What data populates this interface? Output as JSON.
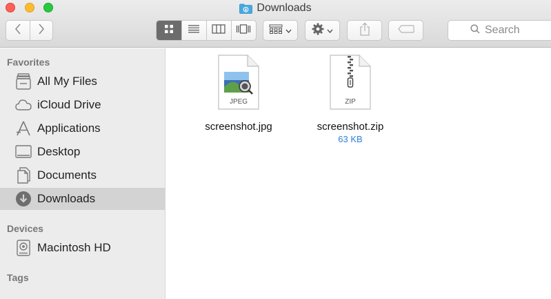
{
  "window": {
    "title": "Downloads",
    "title_icon": "folder-downloads-icon"
  },
  "toolbar": {
    "back_icon": "chevron-left-icon",
    "forward_icon": "chevron-right-icon",
    "view_modes": [
      {
        "icon": "icon-view-icon",
        "active": true
      },
      {
        "icon": "list-view-icon",
        "active": false
      },
      {
        "icon": "column-view-icon",
        "active": false
      },
      {
        "icon": "cover-flow-view-icon",
        "active": false
      }
    ],
    "arrange_icon": "arrange-grid-icon",
    "action_icon": "gear-icon",
    "share_icon": "share-icon",
    "tags_icon": "tag-icon",
    "search": {
      "placeholder": "Search",
      "icon": "search-icon"
    }
  },
  "sidebar": {
    "sections": [
      {
        "header": "Favorites",
        "items": [
          {
            "label": "All My Files",
            "icon": "all-files-icon",
            "selected": false
          },
          {
            "label": "iCloud Drive",
            "icon": "cloud-icon",
            "selected": false
          },
          {
            "label": "Applications",
            "icon": "applications-icon",
            "selected": false
          },
          {
            "label": "Desktop",
            "icon": "desktop-icon",
            "selected": false
          },
          {
            "label": "Documents",
            "icon": "documents-icon",
            "selected": false
          },
          {
            "label": "Downloads",
            "icon": "downloads-icon",
            "selected": true
          }
        ]
      },
      {
        "header": "Devices",
        "items": [
          {
            "label": "Macintosh HD",
            "icon": "hard-drive-icon",
            "selected": false
          }
        ]
      },
      {
        "header": "Tags",
        "items": []
      }
    ]
  },
  "files": [
    {
      "name": "screenshot.jpg",
      "type_label": "JPEG",
      "size": "",
      "icon": "jpeg-file-icon"
    },
    {
      "name": "screenshot.zip",
      "type_label": "ZIP",
      "size": "63 KB",
      "icon": "zip-file-icon"
    }
  ],
  "colors": {
    "close": "#fc5f57",
    "minimize": "#fdbc2e",
    "zoom": "#28c840",
    "selection": "#d3d3d3",
    "size_text": "#2d7fd7",
    "folder_blue": "#4aa8e0"
  }
}
